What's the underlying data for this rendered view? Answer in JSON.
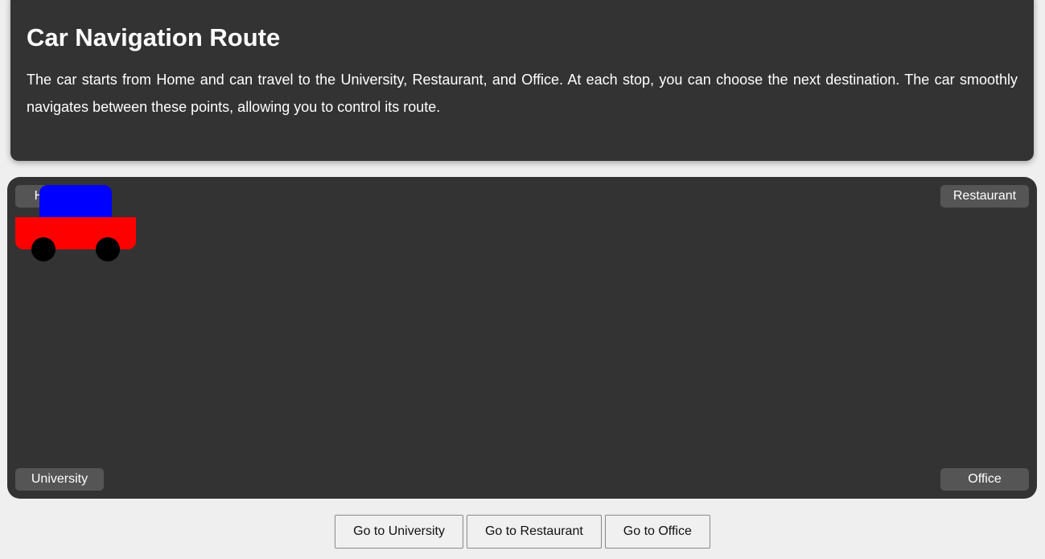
{
  "header": {
    "title": "Car Navigation Route",
    "description": "The car starts from Home and can travel to the University, Restaurant, and Office. At each stop, you can choose the next destination. The car smoothly navigates between these points, allowing you to control its route."
  },
  "map": {
    "locations": {
      "home": "Home",
      "restaurant": "Restaurant",
      "university": "University",
      "office": "Office"
    },
    "car": {
      "current_location": "Home",
      "body_color": "#ff0000",
      "cabin_color": "#0000ff",
      "wheel_color": "#000000"
    }
  },
  "controls": {
    "go_university": "Go to University",
    "go_restaurant": "Go to Restaurant",
    "go_office": "Go to Office"
  },
  "colors": {
    "panel_background": "#333333",
    "page_background": "#efefef",
    "marker_background": "#555555"
  }
}
